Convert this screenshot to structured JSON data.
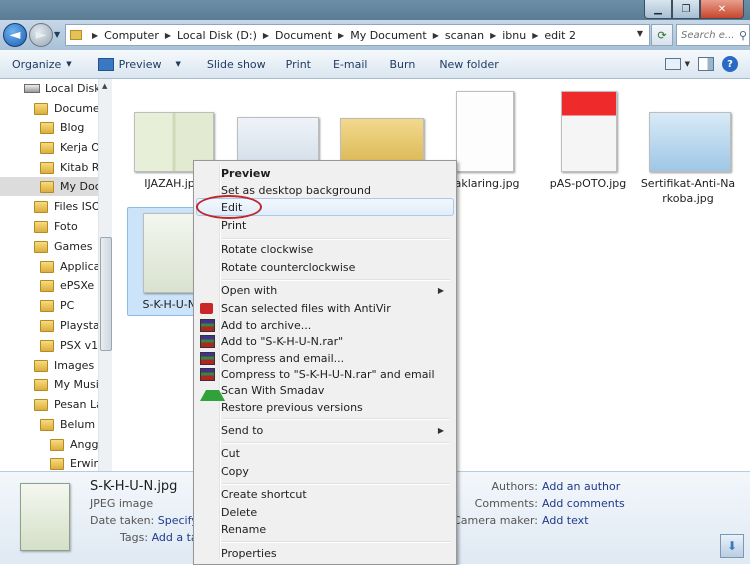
{
  "address": {
    "crumbs": [
      "Computer",
      "Local Disk (D:)",
      "Document",
      "My Document",
      "scanan",
      "ibnu",
      "edit 2"
    ],
    "search_placeholder": "Search e..."
  },
  "toolbar": {
    "organize": "Organize",
    "preview": "Preview",
    "slideshow": "Slide show",
    "print": "Print",
    "email": "E-mail",
    "burn": "Burn",
    "new_folder": "New folder"
  },
  "nav": {
    "items": [
      {
        "label": "Local Disk",
        "level": 0,
        "type": "disk"
      },
      {
        "label": "Documen",
        "level": 1
      },
      {
        "label": "Blog",
        "level": 2
      },
      {
        "label": "Kerja Or",
        "level": 2
      },
      {
        "label": "Kitab Ri",
        "level": 2
      },
      {
        "label": "My Doc",
        "level": 2,
        "selected": true
      },
      {
        "label": "Files ISO",
        "level": 1
      },
      {
        "label": "Foto",
        "level": 1
      },
      {
        "label": "Games",
        "level": 1
      },
      {
        "label": "Applica",
        "level": 2
      },
      {
        "label": "ePSXe v",
        "level": 2
      },
      {
        "label": "PC",
        "level": 2
      },
      {
        "label": "Playstat",
        "level": 2
      },
      {
        "label": "PSX v1.1",
        "level": 2
      },
      {
        "label": "Images",
        "level": 1
      },
      {
        "label": "My Music",
        "level": 1
      },
      {
        "label": "Pesan Lar",
        "level": 1
      },
      {
        "label": "Belum",
        "level": 2
      },
      {
        "label": "Angga",
        "level": 3
      },
      {
        "label": "Erwin",
        "level": 3
      }
    ]
  },
  "files": [
    {
      "name": "IJAZAH.jpg"
    },
    {
      "name": "Paklaring.jpg"
    },
    {
      "name": "pAS-pOTO.jpg"
    },
    {
      "name": "Sertifikat-Anti-Na",
      "name2": "rkoba.jpg"
    },
    {
      "name": "S-K-H-U-N"
    }
  ],
  "context_menu": {
    "preview": "Preview",
    "set_bg": "Set as desktop background",
    "edit": "Edit",
    "print": "Print",
    "rotate_cw": "Rotate clockwise",
    "rotate_ccw": "Rotate counterclockwise",
    "open_with": "Open with",
    "antivir": "Scan selected files with AntiVir",
    "add_archive": "Add to archive...",
    "add_rar": "Add to \"S-K-H-U-N.rar\"",
    "compress_email": "Compress and email...",
    "compress_rar_email": "Compress to \"S-K-H-U-N.rar\" and email",
    "smadav": "Scan With Smadav",
    "restore": "Restore previous versions",
    "send_to": "Send to",
    "cut": "Cut",
    "copy": "Copy",
    "shortcut": "Create shortcut",
    "delete": "Delete",
    "rename": "Rename",
    "properties": "Properties"
  },
  "details": {
    "filename": "S-K-H-U-N.jpg",
    "filetype": "JPEG image",
    "date_key": "Date taken:",
    "date_val": "Specify c",
    "tags_key": "Tags:",
    "tags_val": "Add a ta",
    "authors_key": "Authors:",
    "authors_val": "Add an author",
    "comments_key": "Comments:",
    "comments_val": "Add comments",
    "camera_key": "Camera maker:",
    "camera_val": "Add text"
  },
  "colors": {
    "highlight_circle": "#c0262a",
    "selection": "#cce4fa",
    "link": "#1e3a8a"
  }
}
